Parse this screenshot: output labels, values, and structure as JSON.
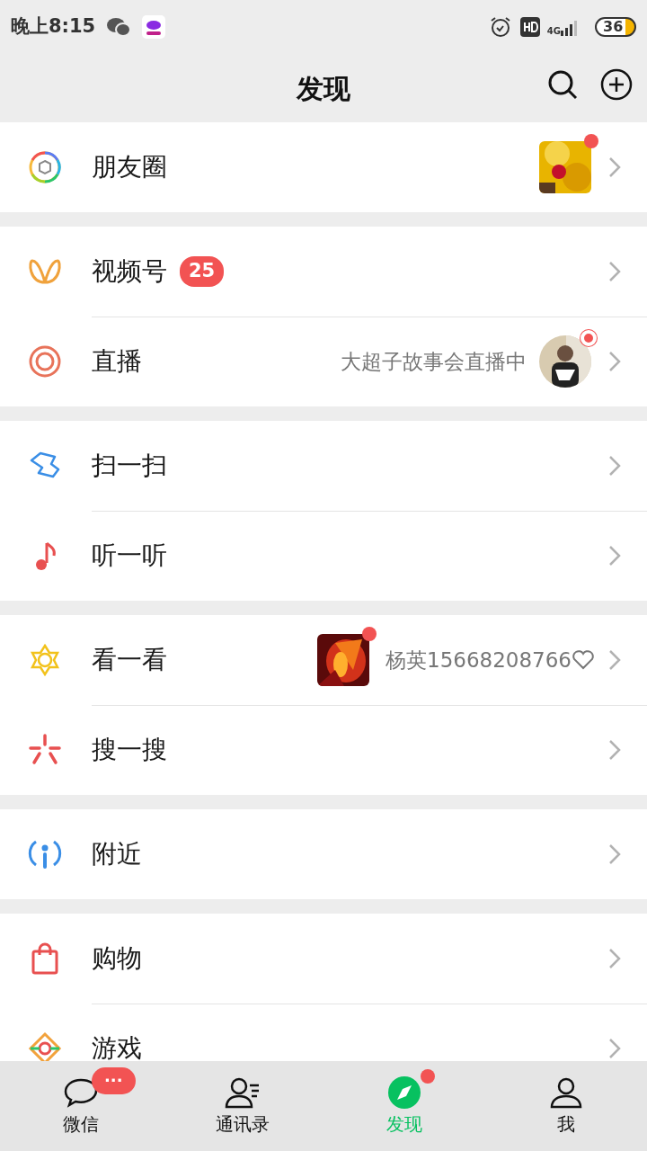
{
  "status_bar": {
    "time": "晚上8:15",
    "network": "4G",
    "battery": "36"
  },
  "header": {
    "title": "发现"
  },
  "groups": [
    {
      "items": [
        {
          "label": "朋友圈",
          "thumbnail": {
            "kind": "picture",
            "round": false
          },
          "new_dot": true
        }
      ]
    },
    {
      "items": [
        {
          "label": "视频号",
          "badge": "25"
        },
        {
          "label": "直播",
          "subtitle": "大超子故事会直播中",
          "thumbnail": {
            "kind": "picture",
            "round": true
          },
          "live_dot": true
        }
      ]
    },
    {
      "items": [
        {
          "label": "扫一扫"
        },
        {
          "label": "听一听"
        }
      ]
    },
    {
      "items": [
        {
          "label": "看一看",
          "thumbnail": {
            "kind": "picture",
            "round": false
          },
          "new_dot": true,
          "subtitle": "杨英15668208766",
          "heart": true
        },
        {
          "label": "搜一搜"
        }
      ]
    },
    {
      "items": [
        {
          "label": "附近"
        }
      ]
    },
    {
      "items": [
        {
          "label": "购物"
        },
        {
          "label": "游戏"
        }
      ]
    }
  ],
  "tab_bar": [
    {
      "label": "微信",
      "selected": false,
      "badge": "···"
    },
    {
      "label": "通讯录",
      "selected": false
    },
    {
      "label": "发现",
      "selected": true,
      "new_dot": true
    },
    {
      "label": "我",
      "selected": false
    }
  ]
}
